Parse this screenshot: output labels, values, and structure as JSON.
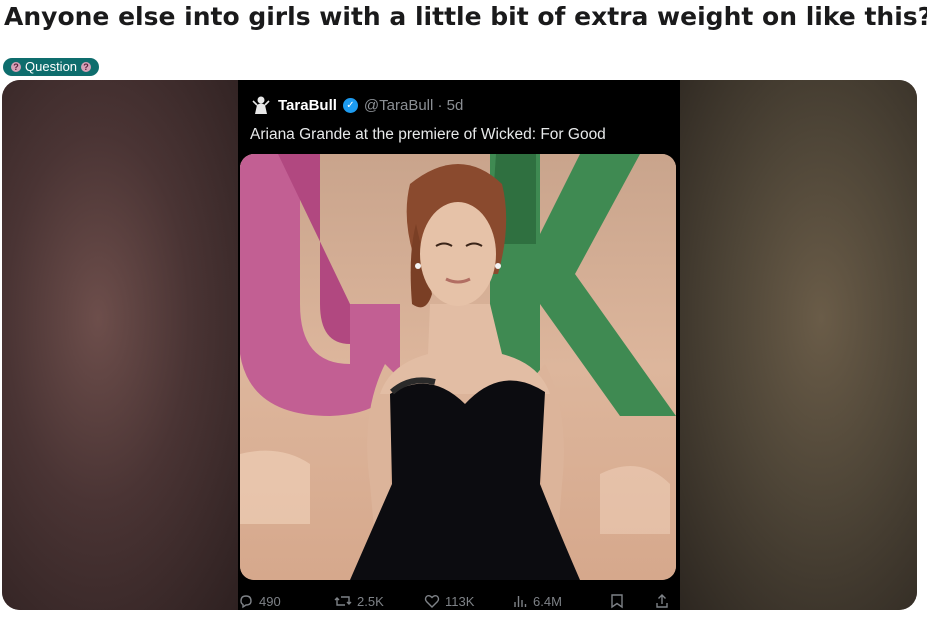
{
  "post": {
    "title": "Anyone else into girls with a little bit of extra weight on like this?",
    "flair": "Question"
  },
  "tweet": {
    "author_name": "TaraBull",
    "handle_time": "@TaraBull · 5d",
    "text": "Ariana Grande at the premiere of Wicked: For Good",
    "metrics": {
      "replies": "490",
      "reposts": "2.5K",
      "likes": "113K",
      "views": "6.4M"
    }
  },
  "icons": {
    "verified": "verified-badge-icon",
    "reply": "reply-icon",
    "repost": "repost-icon",
    "like": "heart-icon",
    "views": "views-icon",
    "bookmark": "bookmark-icon",
    "share": "share-icon"
  },
  "colors": {
    "flair_bg": "#0e6d6d",
    "verified": "#1d9bf0",
    "tweet_bg": "#000000"
  }
}
